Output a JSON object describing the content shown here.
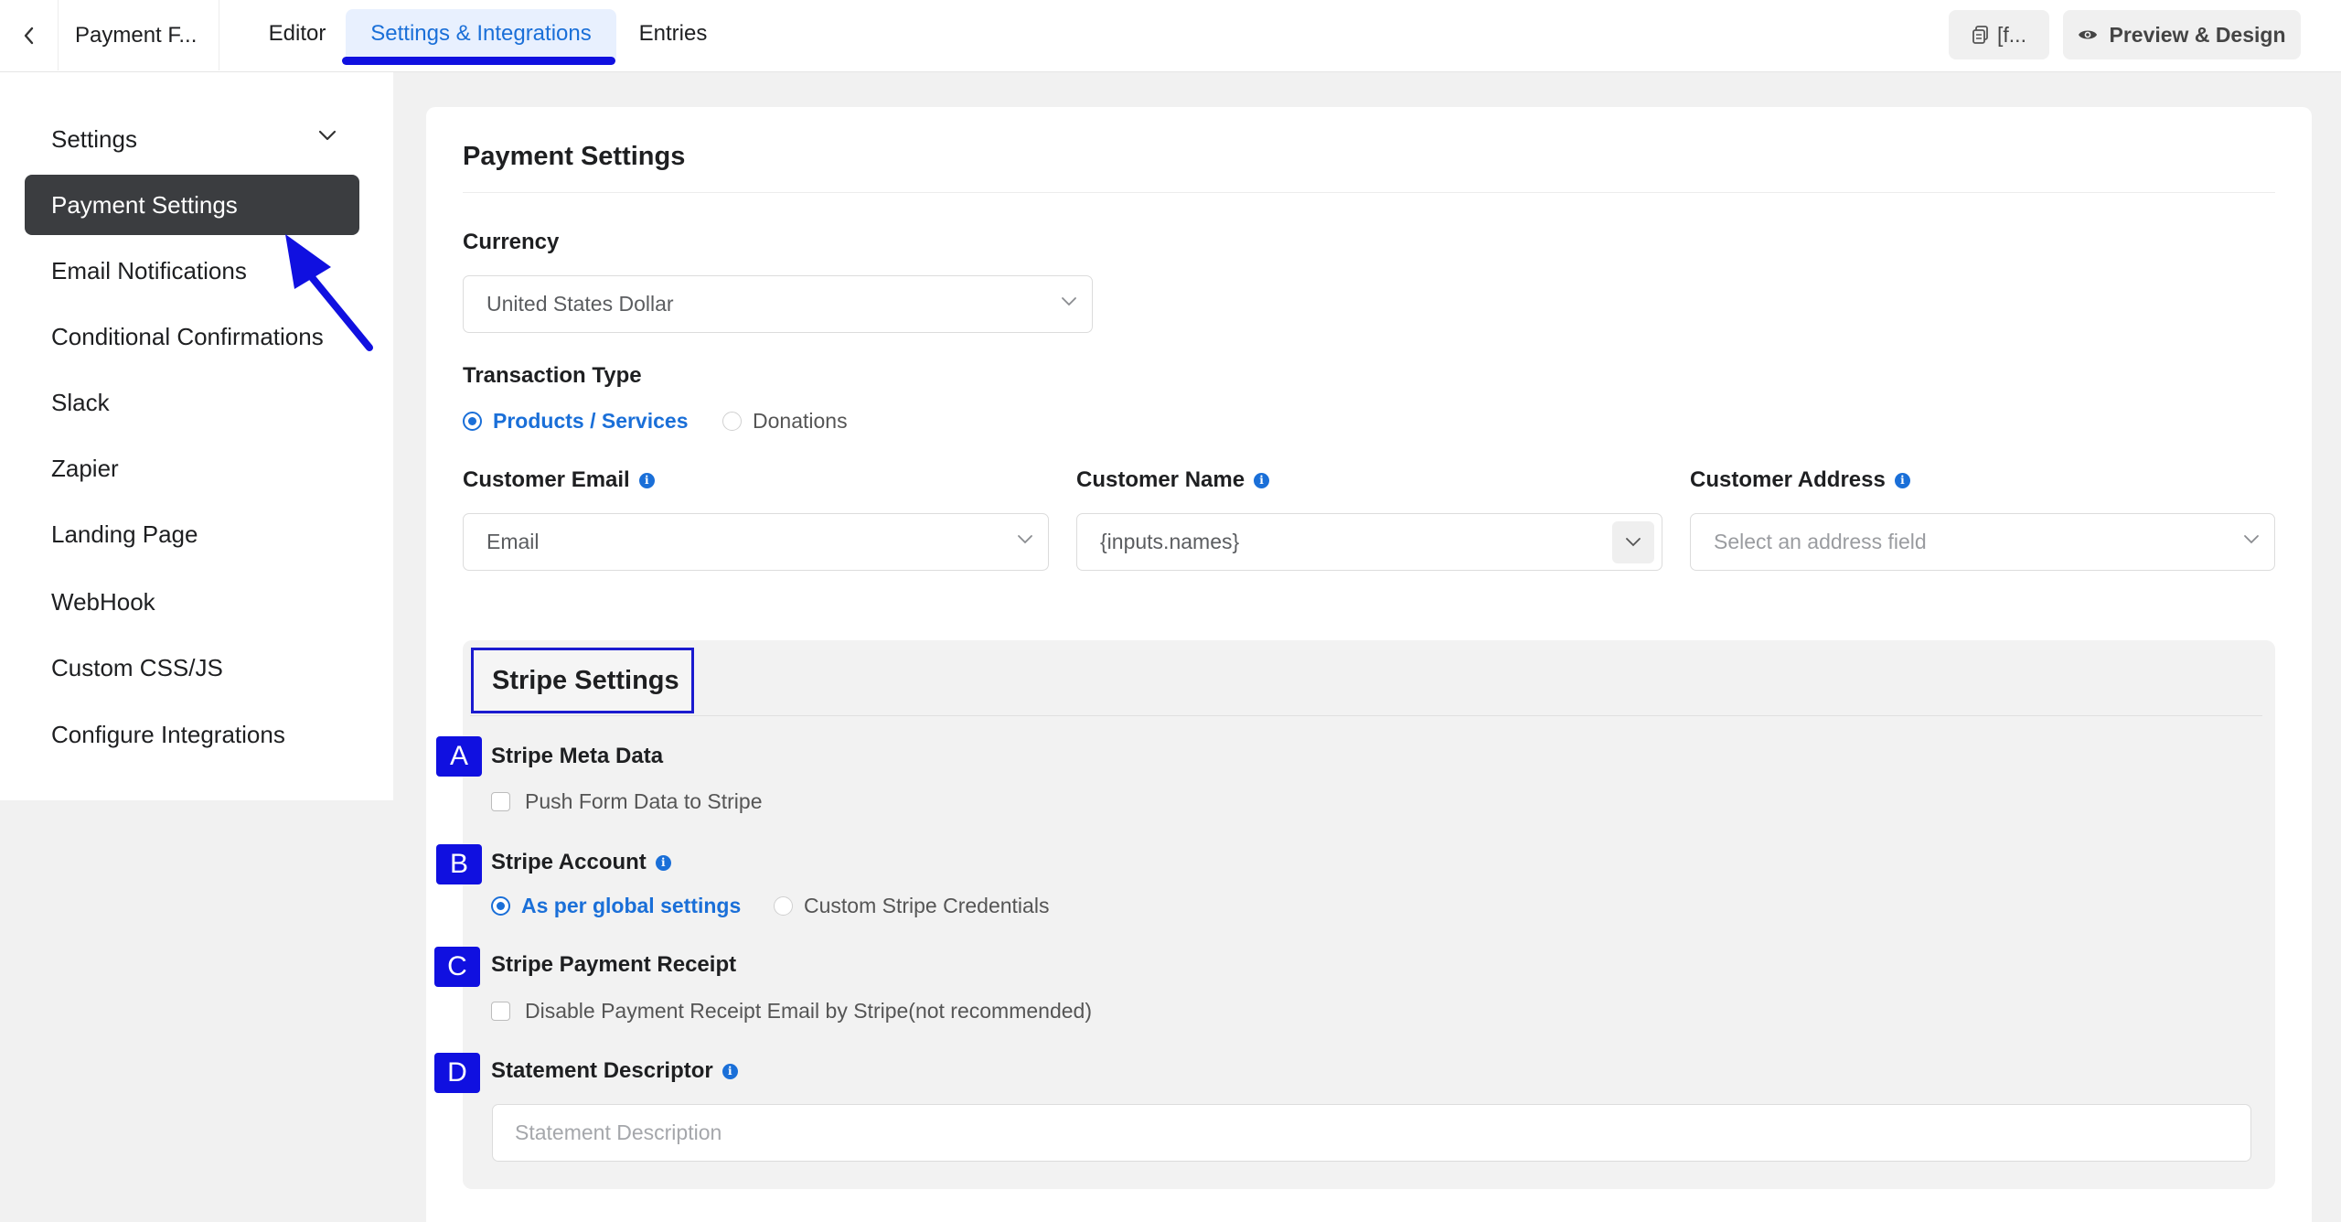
{
  "topbar": {
    "form_name": "Payment F...",
    "tabs": [
      "Editor",
      "Settings & Integrations",
      "Entries"
    ],
    "shortcode_label": "[f...",
    "preview_label": "Preview & Design"
  },
  "sidebar": {
    "items": [
      "Settings",
      "Payment Settings",
      "Email Notifications",
      "Conditional Confirmations",
      "Slack",
      "Zapier",
      "Landing Page",
      "WebHook",
      "Custom CSS/JS",
      "Configure Integrations"
    ],
    "active_index": 1
  },
  "main": {
    "title": "Payment Settings",
    "currency": {
      "label": "Currency",
      "value": "United States Dollar"
    },
    "transaction_type": {
      "label": "Transaction Type",
      "options": [
        "Products / Services",
        "Donations"
      ],
      "selected": "Products / Services"
    },
    "customer_email": {
      "label": "Customer Email",
      "value": "Email"
    },
    "customer_name": {
      "label": "Customer Name",
      "value": "{inputs.names}"
    },
    "customer_address": {
      "label": "Customer Address",
      "placeholder": "Select an address field"
    },
    "stripe": {
      "title": "Stripe Settings",
      "meta_data": {
        "badge": "A",
        "label": "Stripe Meta Data",
        "checkbox_label": "Push Form Data to Stripe"
      },
      "account": {
        "badge": "B",
        "label": "Stripe Account",
        "options": [
          "As per global settings",
          "Custom Stripe Credentials"
        ],
        "selected": "As per global settings"
      },
      "receipt": {
        "badge": "C",
        "label": "Stripe Payment Receipt",
        "checkbox_label": "Disable Payment Receipt Email by Stripe(not recommended)"
      },
      "descriptor": {
        "badge": "D",
        "label": "Statement Descriptor",
        "placeholder": "Statement Description"
      }
    }
  },
  "colors": {
    "accent": "#1a6fd8",
    "annotation": "#1010e0",
    "active_sidebar": "#3b3d40"
  }
}
